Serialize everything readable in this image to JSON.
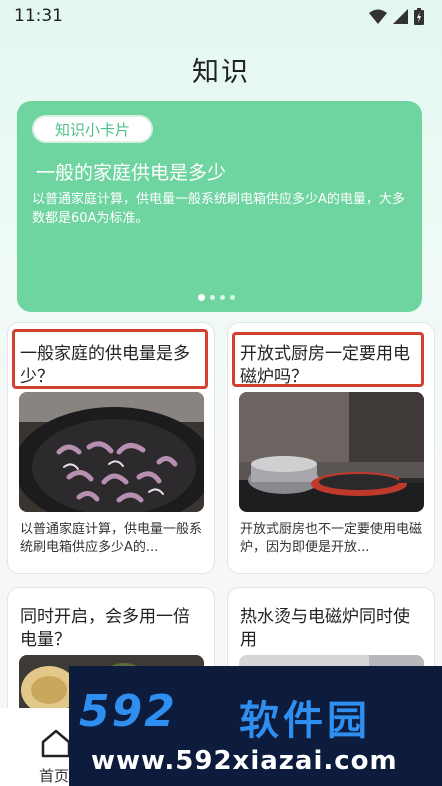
{
  "status_bar": {
    "time": "11:31"
  },
  "header": {
    "title": "知识"
  },
  "banner": {
    "tag": "知识小卡片",
    "title": "一般的家庭供电是多少",
    "description": "以普通家庭计算，供电量一般系统刷电箱供应多少A的电量，大多数都是60A为标准。",
    "page_count": 4,
    "active_page": 1
  },
  "cards": [
    {
      "title": "一般家庭的供电量是多少？",
      "description": "以普通家庭计算，供电量一般系统刷电箱供应多少A的...",
      "image": "frying-onions-pan"
    },
    {
      "title": "开放式厨房一定要用电磁炉吗？",
      "description": "开放式厨房也不一定要使用电磁炉，因为即便是开放...",
      "image": "pans-on-induction-cooktop"
    },
    {
      "title": "同时开启，会多用一倍电量？",
      "image": "food-dishes"
    },
    {
      "title": "热水烫与电磁炉同时使用",
      "image": "appliance"
    }
  ],
  "bottom_nav": {
    "items": [
      {
        "label": "首页",
        "icon": "home-icon"
      }
    ]
  },
  "watermark": {
    "logo": "592",
    "logo_cn": "软件园",
    "url": "www.592xiazai.com"
  },
  "colors": {
    "banner": "#6ed4a0",
    "tag_text": "#4cc08a",
    "highlight_box": "#d0412f",
    "watermark_bg": "#0d1c3c",
    "watermark_logo": "#2e8ff0"
  }
}
